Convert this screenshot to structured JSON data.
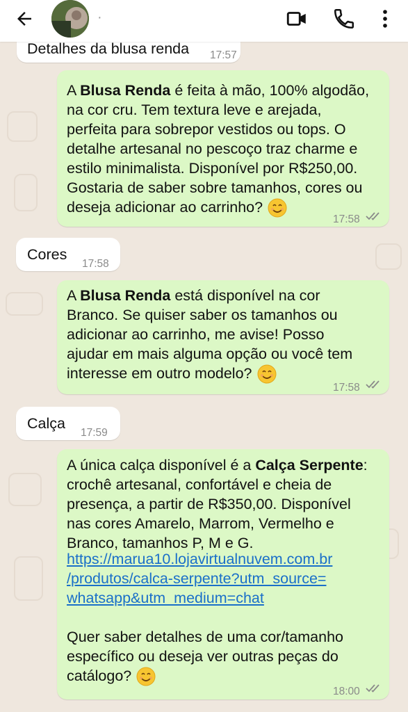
{
  "header": {
    "contact_name": "·"
  },
  "messages": [
    {
      "dir": "in",
      "text": "Detalhes da blusa renda",
      "time": "17:57"
    },
    {
      "dir": "out",
      "pre": "A ",
      "bold": "Blusa Renda",
      "post": " é feita à mão, 100% algodão,\nna cor cru. Tem textura leve e arejada,\nperfeita para sobrepor vestidos ou tops. O\ndetalhe artesanal no pescoço traz charme e\nestilo minimalista. Disponível por R$250,00.\nGostaria de saber sobre tamanhos, cores ou\ndeseja adicionar ao carrinho?",
      "time": "17:58"
    },
    {
      "dir": "in",
      "text": "Cores",
      "time": "17:58"
    },
    {
      "dir": "out",
      "pre": "A ",
      "bold": "Blusa Renda",
      "post": " está disponível na cor\nBranco. Se quiser saber os tamanhos ou\nadicionar ao carrinho, me avise! Posso\najudar em mais alguma opção ou você tem\ninteresse em outro modelo?",
      "time": "17:58"
    },
    {
      "dir": "in",
      "text": "Calça",
      "time": "17:59"
    },
    {
      "dir": "out",
      "pre": "A única calça disponível é a ",
      "bold": "Calça Serpente",
      "post": ":\ncrochê artesanal, confortável e cheia de\npresença, a partir de R$350,00. Disponível\nnas cores Amarelo, Marrom, Vermelho e\nBranco, tamanhos P, M e G.",
      "link": "https://marua10.lojavirtualnuvem.com.br\n/produtos/calca-serpente?utm_source=\nwhatsapp&utm_medium=chat",
      "after": "Quer saber detalhes de uma cor/tamanho\nespecífico ou deseja ver outras peças do\ncatálogo?",
      "time": "18:00"
    }
  ],
  "icons": {
    "back": "arrow-left-icon",
    "video": "video-camera-icon",
    "call": "phone-icon",
    "menu": "more-vertical-icon",
    "read": "double-check-icon",
    "emoji": "smiling-face-emoji"
  },
  "colors": {
    "outgoing": "#dcf8c6",
    "incoming": "#ffffff",
    "link": "#1a6fc9",
    "ticks": "#8a8a8a"
  }
}
